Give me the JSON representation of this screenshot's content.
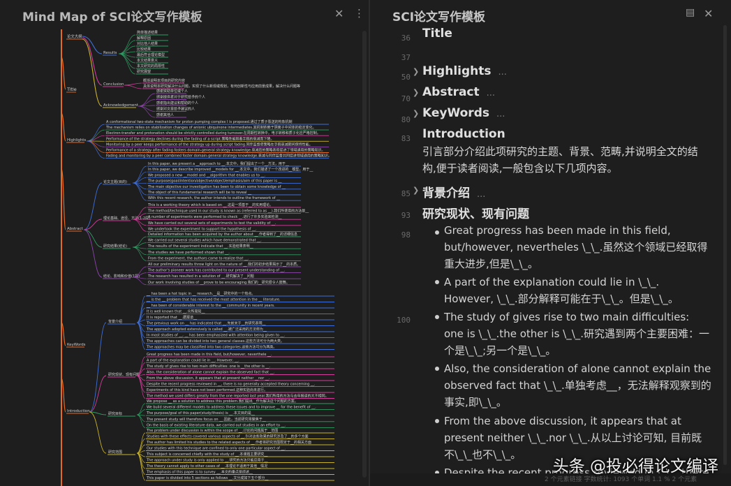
{
  "left_panel": {
    "title": "Mind Map of SCI论文写作模板",
    "close_icon": "close-icon",
    "more_icon": "more-vertical-icon",
    "branch_colors": [
      "#e56b25",
      "#3f6fd8",
      "#2f9e63",
      "#d43c9b",
      "#c9b22c",
      "#8e44ad"
    ],
    "map": {
      "top_label": "论文大纲",
      "title_node": "Title",
      "results_node": "Results",
      "results_items": [
        "简单描述结果",
        "解释原因",
        "对比他人结果",
        "比较结果",
        "最后符合理论模型",
        "本文结果意义",
        "本文研究的局限性",
        "研究展望"
      ],
      "conclusion_node": "Conclusion",
      "conclusion_items": [
        "概括说明本项目的研究内容",
        "具体说明本研究解决什么问题，实现了什么新现或规划，有何创新性与应用前景成果，解决什么问题等"
      ],
      "ack_node": "Acknowledgement",
      "ack_items": [
        "感谢资助单位或个人",
        "感谢提供者对于研究给予的个人",
        "感谢指出建议和帮助的个人",
        "感谢对文章给予建议的人",
        "感谢其他人"
      ],
      "highlights_node": "Highlights",
      "highlights_items": [
        "A conformational two-state mechanism for proton pumping complex I is proposed.通过了质子泵送的构象机制",
        "The mechanism relies on stabilization changes of anionic ubiquinone intermediates.其机制依赖于阴离子中间体的稳定变化。",
        "Electron-transfer and protonation should be strictly controlled during turnover.在周期性转换中，电子转移和质子化应严格控制。",
        "Performance of the strategy declines during the fading of a script.策略性能随着手稿的衰减而下降。",
        "Monitoring by a peer keeps performance of the strategy up during script fading.同伴监督使策略在手稿衰减期间保持性能。",
        "Performance of a strategy after fading fosters domain-general strategy knowledge.衰减后的策略表现促进了领域通用的策略知识。",
        "Fading and monitoring by a peer combined foster domain-general strategy knowledge.衰减与同伴监督共同促进领域通用的策略知识。"
      ],
      "abstract_node": "Abstract",
      "abs_groups": [
        "论文主题(目的)",
        "理论基础、途径、方法(1-2段)",
        "研究结果(结论)",
        "结论、影响和价值(1段)"
      ],
      "abs_g1": [
        "In this paper, we present a __approach to __.本文中，我们提出了一个__方法，用于__",
        "In this paper, we describe improved __models for __.本文中，我们描述了一个改进的__模型，用于__",
        "We proposed a new __model and __algorithm that enables us to __.",
        "The purpose(goal/intention/objective/object/emphasis/aim of this paper is __",
        "The main objective our investigation has been to obtain some knowledge of __",
        "The object of this fundamental research will be to reveal __",
        "With this recent research, the author intends to outline the framework of __"
      ],
      "abs_g2": [
        "This is a working theory which is based on __.这是一项基于__的实用理论。",
        "The method/technique used in our study is known as (referred to as __).我们所使用的方法是__",
        "A number of experiments were performed to check __.进行了许多实验来检测__",
        "We have carried out several sets of experiments to test the validity of __.",
        "We undertook the experiment to support the hypothesis of __."
      ],
      "abs_g3": [
        "Detailed information has been acquired by the author about __.作者得到了__的详细信息",
        "We carried out several studies which have demonstrated that __.",
        "The results of the experiment indicate that __.实验结果表明__",
        "The studies we have performed shown that __.",
        "From the experiment, the authors came to realize that __."
      ],
      "abs_g4": [
        "All our preliminary results throw light on the nature of __.我们的初步结果揭示了__的本质。",
        "The author's pioneer work has contributed to our present understanding of __.",
        "The research has resulted in a solution of __.研究解决了__问题",
        "Our work involving studies of __prove to be encouraging.我们的__研究很令人鼓舞。"
      ],
      "keywords_node": "KeyWords",
      "intro_node": "Introduction",
      "intro_groups": [
        "背景介绍",
        "研究现状、现有问题",
        "研究目标",
        "研究范围"
      ],
      "intro_g1": [
        "__ has been a hot topic in __ research.__是__研究中的一个热点。",
        "__ is the __ problem that has received the most attention in the __ literature.",
        "__ has been of considerable interest to the __ community in recent years.",
        "It is well known that __.众所周知__",
        "It is reported that __.据报道__",
        "The previous work on __ has indicated that __.先前关于__的研究表明__",
        "The approach adopted extensively is called __.被广泛采用的方法称为__",
        "In most studies of __, __ has been emphasized with attention being given to __.",
        "The approaches can be divided into two general classes.这些方法可分为两大类。",
        "The approaches may be classified into two categories.这些方法可分为两类。"
      ],
      "intro_g2": [
        "Great progress has been made in this field, but/however, neverthele __.",
        "A part of the explanation could lie in __. However, __.",
        "The study of gives rise to two main difficulties: one is __the other is __.",
        "Also, the consideration of alone cannot explain the observed fact that __.",
        "From the above discussion, it appears that at present neither __nor __.",
        "Despite the recent progress reviewed in __, there is no generally accepted theory concerning __.",
        "Experiments of this kind have not been performed.这种实验尚未进行。",
        "The method we used differs greatly from the one reported last year.我们所用的方法与去年报道的大不相同。"
      ],
      "intro_g3": [
        "We propose __ as a solution to address this problem.我们提出__作为解决这个问题的方案。",
        "We build several different models to address these issues and to improve __ for the benefit of __.",
        "The purpose/goal of this paper(study/thesis) is __.本文目的是__",
        "The present study will therefore focus on __.因此，当前研究将聚焦于__",
        "On the basis of existing literature data, we carried out studies in an effort to __."
      ],
      "intro_g4": [
        "The problem under discussion is within the scope of __.讨论的问题属于__范围",
        "Studies with these effects covered various aspects of __.针对这些效果的研究涉及了__的多个方面",
        "The author has limited his studies to the related aspects of __.作者将研究范围限定于__的相关方面",
        "Our studies with this technique are confined to only one particular aspect of __.",
        "This subject is concerned chiefly with the study of __.本课题主要研究__",
        "The approach under study is only applied to __.研究的方法只能应用于__",
        "The theory cannot apply to other cases of __.本理论不适用于其他__情况",
        "The emphasis of this paper is to survey __.本文的重点是综述__",
        "This paper is divided into 5 sections as follows __.文分成如下五个部分__"
      ]
    }
  },
  "right_panel": {
    "title": "SCI论文写作模板",
    "outline_icon": "outline-icon",
    "close_icon": "close-icon",
    "lines": [
      {
        "num": "36",
        "heading": "Title",
        "collapsible": false,
        "ellipsis": ""
      },
      {
        "num": "37",
        "heading": "",
        "collapsible": false,
        "ellipsis": ""
      },
      {
        "num": "",
        "heading": "Highlights",
        "collapsible": true,
        "ellipsis": "..."
      },
      {
        "num": "",
        "heading": "Abstract",
        "collapsible": true,
        "ellipsis": "..."
      },
      {
        "num": "",
        "heading": "KeyWords",
        "collapsible": true,
        "ellipsis": "..."
      },
      {
        "num": "80",
        "heading": "Introduction",
        "collapsible": false,
        "ellipsis": ""
      }
    ],
    "line_numbers": [
      "36",
      "37",
      "50",
      "70",
      "80",
      "",
      "83",
      "85",
      "93",
      "98",
      "100",
      "",
      "",
      "",
      "",
      "",
      "",
      ""
    ],
    "intro_text": "引言部分介绍此项研究的主题、背景、范畴,并说明全文的结构,便于读者阅读,一般包含以下几项内容。",
    "bg_heading": "背景介绍",
    "bg_ellipsis": "...",
    "status_heading": "研究现状、现有问题",
    "bullets": [
      "Great progress has been made in this field, but/however, nevertheles \\_\\_.虽然这个领域已经取得重大进步,但是\\_\\_。",
      "A part of the explanation could lie in \\_\\_. However, \\_\\_.部分解释可能在于\\_\\_。但是\\_\\_。",
      "The study of gives rise to two main difficulties: one is \\_\\_.the other is \\_\\_.研究遇到两个主要困难：一个是\\_\\_;另一个是\\_\\_。",
      "Also, the consideration of alone cannot explain the observed fact that \\_\\_.单独考虑__，无法解释观察到的事实,即\\_\\_。",
      "From the above discussion, it appears that at present neither \\_\\_.nor \\_\\_.从以上讨论可知, 目前既不\\_\\_也不\\_\\_。",
      "Despite the recent progress reviewed in \\_\\_, there is"
    ],
    "statusbar_text": "2 个元素链接    字数统计: 1093 个单词    1.1 % 2 个元素",
    "watermark": "头条 @投必得论文编译"
  }
}
